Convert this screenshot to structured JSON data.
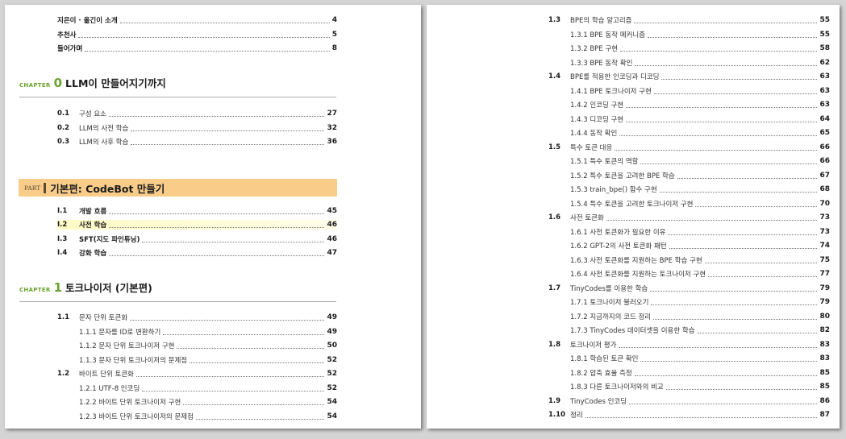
{
  "left_page": {
    "front_matter": [
      {
        "label": "지은이 · 옮긴이 소개",
        "page": "4"
      },
      {
        "label": "추천사",
        "page": "5"
      },
      {
        "label": "들어가며",
        "page": "8"
      }
    ],
    "chapter0": {
      "word": "CHAPTER",
      "number": "0",
      "title": "LLM이 만들어지기까지",
      "sections": [
        {
          "num": "0.1",
          "label": "구성 요소",
          "page": "27"
        },
        {
          "num": "0.2",
          "label": "LLM의 사전 학습",
          "page": "32"
        },
        {
          "num": "0.3",
          "label": "LLM의 사후 학습",
          "page": "36"
        }
      ]
    },
    "part1": {
      "word": "PART",
      "title": "기본편: CodeBot 만들기",
      "sections": [
        {
          "num": "I.1",
          "label": "개발 흐름",
          "page": "45"
        },
        {
          "num": "I.2",
          "label": "사전 학습",
          "page": "46"
        },
        {
          "num": "I.3",
          "label": "SFT(지도 파인튜닝)",
          "page": "46"
        },
        {
          "num": "I.4",
          "label": "강화 학습",
          "page": "47"
        }
      ]
    },
    "chapter1": {
      "word": "CHAPTER",
      "number": "1",
      "title": "토크나이저 (기본편)",
      "entries": [
        {
          "num": "1.1",
          "label": "문자 단위 토큰화",
          "page": "49"
        },
        {
          "num": "",
          "label": "1.1.1 문자를 ID로 변환하기",
          "page": "49"
        },
        {
          "num": "",
          "label": "1.1.2  문자 단위 토크나이저 구현",
          "page": "50"
        },
        {
          "num": "",
          "label": "1.1.3 문자 단위 토크나이저의 문제점",
          "page": "52"
        },
        {
          "num": "1.2",
          "label": "바이트 단위 토큰화",
          "page": "52"
        },
        {
          "num": "",
          "label": "1.2.1 UTF-8 인코딩",
          "page": "52"
        },
        {
          "num": "",
          "label": "1.2.2 바이트 단위 토크나이저 구현",
          "page": "54"
        },
        {
          "num": "",
          "label": "1.2.3 바이트 단위 토크나이저의 문제점",
          "page": "54"
        }
      ]
    }
  },
  "right_page": {
    "entries": [
      {
        "num": "1.3",
        "label": "BPE의 학습 알고리즘",
        "page": "55"
      },
      {
        "num": "",
        "label": "1.3.1 BPE 동작 메커니즘",
        "page": "55"
      },
      {
        "num": "",
        "label": "1.3.2 BPE 구현",
        "page": "58"
      },
      {
        "num": "",
        "label": "1.3.3 BPE 동작 확인",
        "page": "62"
      },
      {
        "num": "1.4",
        "label": "BPE를 적용한 인코딩과 디코딩",
        "page": "63"
      },
      {
        "num": "",
        "label": "1.4.1 BPE 토크나이저 구현",
        "page": "63"
      },
      {
        "num": "",
        "label": "1.4.2 인코딩 구현",
        "page": "63"
      },
      {
        "num": "",
        "label": "1.4.3 디코딩 구현",
        "page": "64"
      },
      {
        "num": "",
        "label": "1.4.4 동작 확인",
        "page": "65"
      },
      {
        "num": "1.5",
        "label": "특수 토큰 대응",
        "page": "66"
      },
      {
        "num": "",
        "label": "1.5.1 특수 토큰의 역할",
        "page": "66"
      },
      {
        "num": "",
        "label": "1.5.2 특수 토큰을 고려한 BPE 학습",
        "page": "67"
      },
      {
        "num": "",
        "label": "1.5.3 train_bpe() 함수 구현",
        "page": "68"
      },
      {
        "num": "",
        "label": "1.5.4 특수 토큰을 고려한 토크나이저 구현",
        "page": "70"
      },
      {
        "num": "1.6",
        "label": "사전 토큰화",
        "page": "73"
      },
      {
        "num": "",
        "label": "1.6.1 사전 토큰화가 필요한 이유",
        "page": "73"
      },
      {
        "num": "",
        "label": "1.6.2 GPT-2의 사전 토큰화 패턴",
        "page": "74"
      },
      {
        "num": "",
        "label": "1.6.3 사전 토큰화를 지원하는 BPE 학습 구현",
        "page": "75"
      },
      {
        "num": "",
        "label": "1.6.4 사전 토큰화를 지원하는 토크나이저 구현",
        "page": "77"
      },
      {
        "num": "1.7",
        "label": "TinyCodes를 이용한 학습",
        "page": "79"
      },
      {
        "num": "",
        "label": "1.7.1 토크나이저 불러오기",
        "page": "79"
      },
      {
        "num": "",
        "label": "1.7.2 지금까지의 코드 정리",
        "page": "80"
      },
      {
        "num": "",
        "label": "1.7.3 TinyCodes 데이터셋을 이용한 학습",
        "page": "82"
      },
      {
        "num": "1.8",
        "label": "토크나이저 평가",
        "page": "83"
      },
      {
        "num": "",
        "label": "1.8.1 학습된 토큰 확인",
        "page": "83"
      },
      {
        "num": "",
        "label": "1.8.2 압축 효율 측정",
        "page": "85"
      },
      {
        "num": "",
        "label": "1.8.3 다른 토크나이저와의 비교",
        "page": "85"
      },
      {
        "num": "1.9",
        "label": "TinyCodes 인코딩",
        "page": "86"
      },
      {
        "num": "1.10",
        "label": "정리",
        "page": "87"
      }
    ]
  },
  "colors": {
    "chapter_accent": "#6aa22b",
    "part_bar": "#f9cc8a",
    "highlight": "#fffac0"
  }
}
